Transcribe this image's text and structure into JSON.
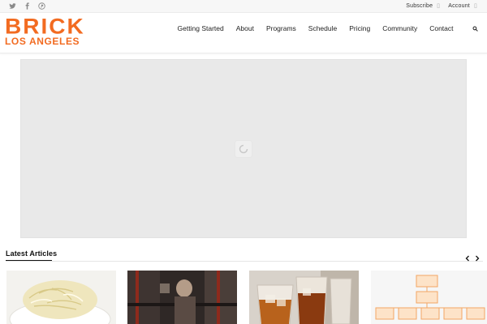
{
  "topbar": {
    "social": [
      "twitter-icon",
      "facebook-icon",
      "pinterest-icon"
    ],
    "links": [
      {
        "label": "Subscribe",
        "icon": "divider-icon"
      },
      {
        "label": "Account",
        "icon": "divider-icon"
      }
    ]
  },
  "brand": {
    "name": "BRICK",
    "city": "LOS ANGELES",
    "accent": "#f26b21"
  },
  "nav": {
    "items": [
      "Getting Started",
      "About",
      "Programs",
      "Schedule",
      "Pricing",
      "Community",
      "Contact"
    ],
    "search_icon": "search-icon"
  },
  "hero": {
    "state": "loading",
    "icon": "loading-spinner-icon"
  },
  "latest": {
    "title": "Latest Articles",
    "prev_icon": "chevron-left-icon",
    "next_icon": "chevron-right-icon",
    "articles": [
      {
        "thumbnail": "shredded-cabbage-bowl"
      },
      {
        "thumbnail": "gym-barbell-room"
      },
      {
        "thumbnail": "whiskey-glasses"
      },
      {
        "thumbnail": "flowchart-diagram"
      }
    ]
  }
}
